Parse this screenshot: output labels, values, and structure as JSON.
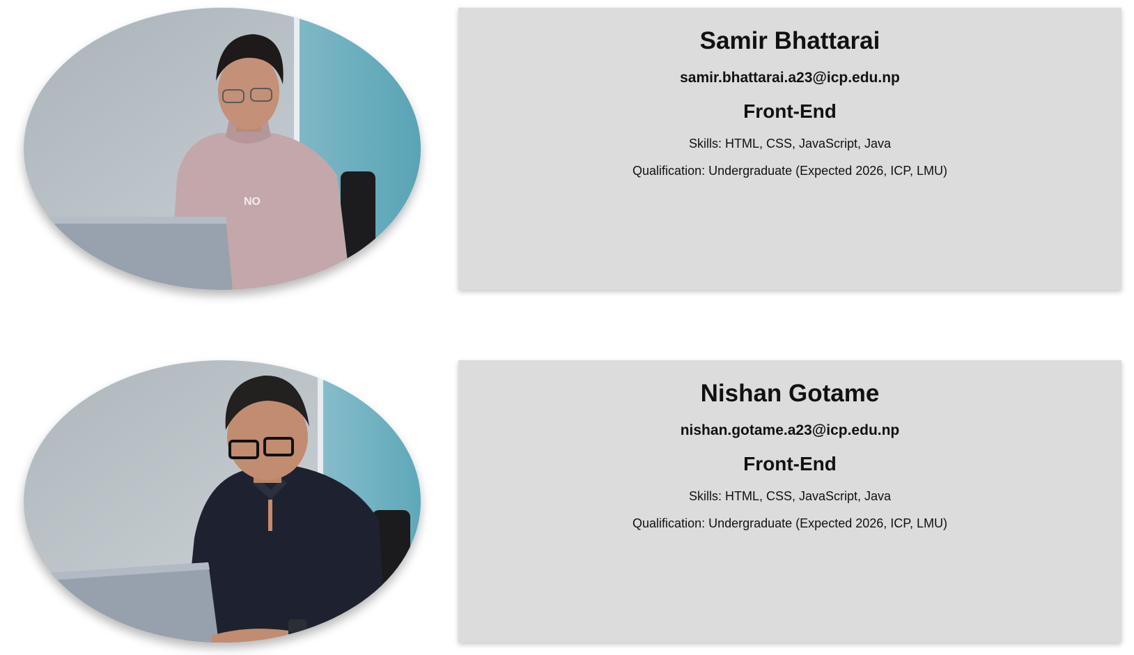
{
  "members": [
    {
      "name": "Samir Bhattarai",
      "email": "samir.bhattarai.a23@icp.edu.np",
      "role": "Front-End",
      "skills": "Skills: HTML, CSS, JavaScript, Java",
      "qualification": "Qualification: Undergraduate (Expected 2026, ICP, LMU)",
      "sweater_text": "NO"
    },
    {
      "name": "Nishan Gotame",
      "email": "nishan.gotame.a23@icp.edu.np",
      "role": "Front-End",
      "skills": "Skills: HTML, CSS, JavaScript, Java",
      "qualification": "Qualification: Undergraduate (Expected 2026, ICP, LMU)"
    }
  ],
  "colors": {
    "card_background": "#dcdcdc",
    "wall": "#b9c2c8",
    "glass": "#6aaebd",
    "laptop": "#98a2ae",
    "sweater_pink": "#c4a7aa",
    "shirt_navy": "#1e2230"
  }
}
